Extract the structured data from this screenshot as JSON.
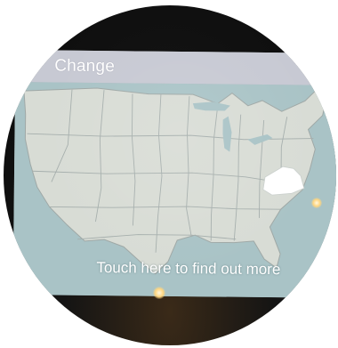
{
  "header": {
    "title": "Change"
  },
  "map": {
    "type": "us-states-map",
    "highlighted_state": "Virginia",
    "ocean_color": "#a8c3c6",
    "land_color": "#d9ddd6",
    "highlight_color": "#ffffff"
  },
  "call_to_action": {
    "label": "Touch here to find out more"
  },
  "colors": {
    "header": "#c7c9d3",
    "screen": "#b9cbcc",
    "bezel": "#111111"
  }
}
